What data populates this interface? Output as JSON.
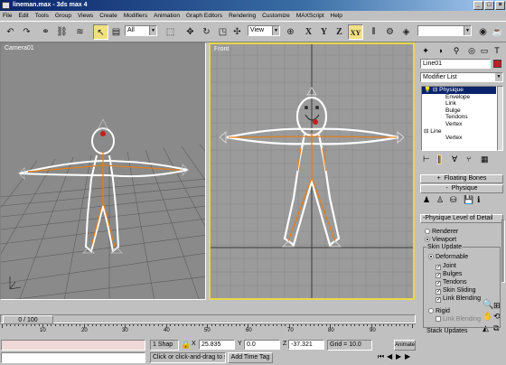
{
  "window": {
    "title": "lineman.max - 3ds max 4",
    "controls": [
      "_",
      "□",
      "×"
    ]
  },
  "menu": [
    "File",
    "Edit",
    "Tools",
    "Group",
    "Views",
    "Create",
    "Modifiers",
    "Animation",
    "Graph Editors",
    "Rendering",
    "Customize",
    "MAXScript",
    "Help"
  ],
  "toolbar": {
    "selection_filter": "All",
    "ref_coord": "View",
    "axis_x": "X",
    "axis_y": "Y",
    "axis_z": "Z",
    "axis_xy": "XY",
    "named_selection": ""
  },
  "viewports": {
    "camera_label": "Camera01",
    "front_label": "Front"
  },
  "time": {
    "slider_label": "0 / 100",
    "ticks": [
      "10",
      "20",
      "30",
      "40",
      "50",
      "60",
      "70",
      "80",
      "90"
    ]
  },
  "status": {
    "selection_count": "1 Shap",
    "x_label": "X",
    "x_value": "25.835",
    "y_label": "Y",
    "y_value": "0.0",
    "z_label": "Z",
    "z_value": "-37.321",
    "grid": "Grid = 10.0",
    "prompt": "Click or click-and-drag to s",
    "add_time_tag": "Add Time Tag",
    "animate": "Animate"
  },
  "command_panel": {
    "object_name": "Line01",
    "object_color": "#c02020",
    "modifier_list": "Modifier List",
    "stack": [
      {
        "label": "Physique",
        "level": 0,
        "expanded": true,
        "selected": true
      },
      {
        "label": "Envelope",
        "level": 1
      },
      {
        "label": "Link",
        "level": 1
      },
      {
        "label": "Bulge",
        "level": 1
      },
      {
        "label": "Tendons",
        "level": 1
      },
      {
        "label": "Vertex",
        "level": 1
      },
      {
        "label": "Line",
        "level": 0,
        "expanded": true
      },
      {
        "label": "Vertex",
        "level": 1
      }
    ],
    "rollouts": {
      "floating_bones": "Floating Bones",
      "physique": "Physique",
      "physique_lod": "Physique Level of Detail"
    },
    "lod": {
      "renderer": "Renderer",
      "viewport": "Viewport",
      "skin_update": "Skin Update",
      "deformable": "Deformable",
      "joint": "Joint",
      "bulges": "Bulges",
      "tendons": "Tendons",
      "skin_sliding": "Skin Sliding",
      "link_blending_1": "Link Blending",
      "rigid": "Rigid",
      "link_blending_2": "Link Blending",
      "stack_updates": "Stack Updates"
    }
  },
  "colors": {
    "active_viewport_border": "#e8d84c",
    "skin_line": "#ffffff",
    "bones": "#e08020",
    "selection_bracket": "#ffffff"
  }
}
